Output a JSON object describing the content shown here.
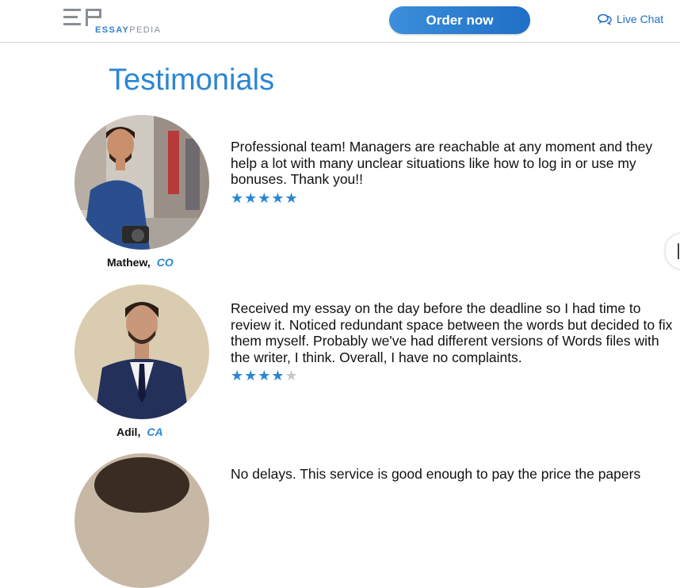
{
  "header": {
    "logo_part1": "ESSAY",
    "logo_part2": "PEDIA",
    "order_button": "Order now",
    "live_chat": "Live Chat"
  },
  "page_title": "Testimonials",
  "testimonials": [
    {
      "name": "Mathew,",
      "state": "CO",
      "text": "Professional team! Managers are reachable at any moment and they help a lot with many unclear situations like how to log in or use my bonuses. Thank you!!",
      "stars_filled": "★★★★★",
      "stars_empty": "",
      "rating": 5
    },
    {
      "name": "Adil,",
      "state": "CA",
      "text": "Received my essay on the day before the deadline so I had time to review it. Noticed redundant space between the words but decided to fix them myself. Probably we've had different versions of Words files with the writer, I think. Overall, I have no complaints.",
      "stars_filled": "★★★★",
      "stars_empty": "★",
      "rating": 4
    },
    {
      "text": "No delays. This service is good enough to pay the price the papers"
    }
  ],
  "colors": {
    "accent": "#2a86d4",
    "button": "#1f6fc6"
  }
}
